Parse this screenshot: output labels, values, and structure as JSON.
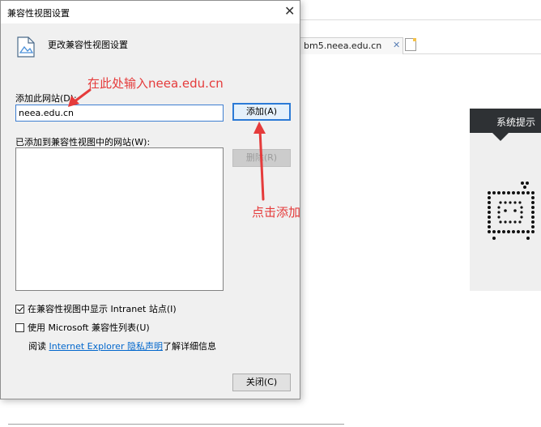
{
  "dialog": {
    "title": "兼容性视图设置",
    "header_text": "更改兼容性视图设置",
    "add_site_label": "添加此网站(D):",
    "site_input_value": "neea.edu.cn",
    "add_button": "添加(A)",
    "list_label": "已添加到兼容性视图中的网站(W):",
    "remove_button": "删除(R)",
    "checkbox_intranet": "在兼容性视图中显示 Intranet 站点(I)",
    "checkbox_intranet_checked": true,
    "checkbox_mslist": "使用 Microsoft 兼容性列表(U)",
    "checkbox_mslist_checked": false,
    "privacy_prefix": "阅读",
    "privacy_link": "Internet Explorer 隐私声明",
    "privacy_suffix": "了解详细信息",
    "close_button": "关闭(C)"
  },
  "background": {
    "tab_label": "bm5.neea.edu.cn",
    "panel_title": "系统提示"
  },
  "annotations": {
    "enter_hint": "在此处输入neea.edu.cn",
    "click_hint": "点击添加",
    "color": "#e53b3b"
  },
  "icons": {
    "close": "close-icon",
    "header": "page-icon",
    "tab_close": "close-icon",
    "new_tab": "new-tab-icon"
  }
}
